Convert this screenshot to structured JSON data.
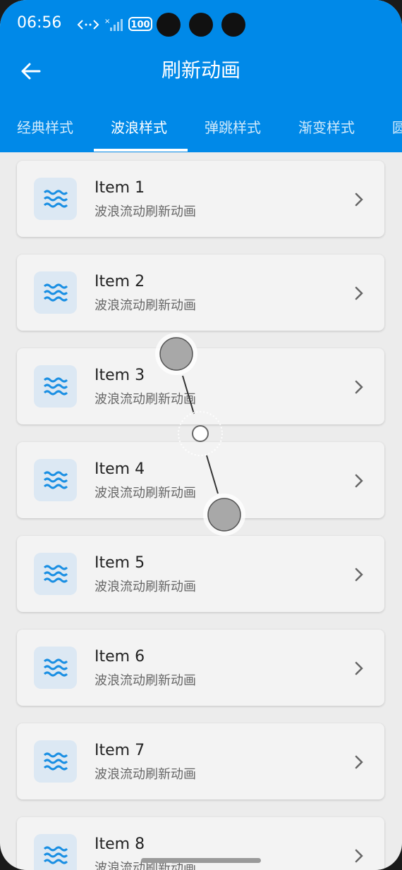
{
  "status": {
    "time": "06:56",
    "battery": "100"
  },
  "toolbar": {
    "title": "刷新动画"
  },
  "tabs": [
    {
      "label": "经典样式"
    },
    {
      "label": "波浪样式"
    },
    {
      "label": "弹跳样式"
    },
    {
      "label": "渐变样式"
    },
    {
      "label": "圆"
    }
  ],
  "active_tab": 1,
  "items": [
    {
      "title": "Item 1",
      "subtitle": "波浪流动刷新动画"
    },
    {
      "title": "Item 2",
      "subtitle": "波浪流动刷新动画"
    },
    {
      "title": "Item 3",
      "subtitle": "波浪流动刷新动画"
    },
    {
      "title": "Item 4",
      "subtitle": "波浪流动刷新动画"
    },
    {
      "title": "Item 5",
      "subtitle": "波浪流动刷新动画"
    },
    {
      "title": "Item 6",
      "subtitle": "波浪流动刷新动画"
    },
    {
      "title": "Item 7",
      "subtitle": "波浪流动刷新动画"
    },
    {
      "title": "Item 8",
      "subtitle": "波浪流动刷新动画"
    }
  ],
  "colors": {
    "primary": "#0089e8",
    "icon_bg": "#dce8f3",
    "wave": "#1a8fe3"
  },
  "icons": {
    "back": "arrow-left-icon",
    "item": "wave-icon",
    "row": "chevron-right-icon"
  }
}
